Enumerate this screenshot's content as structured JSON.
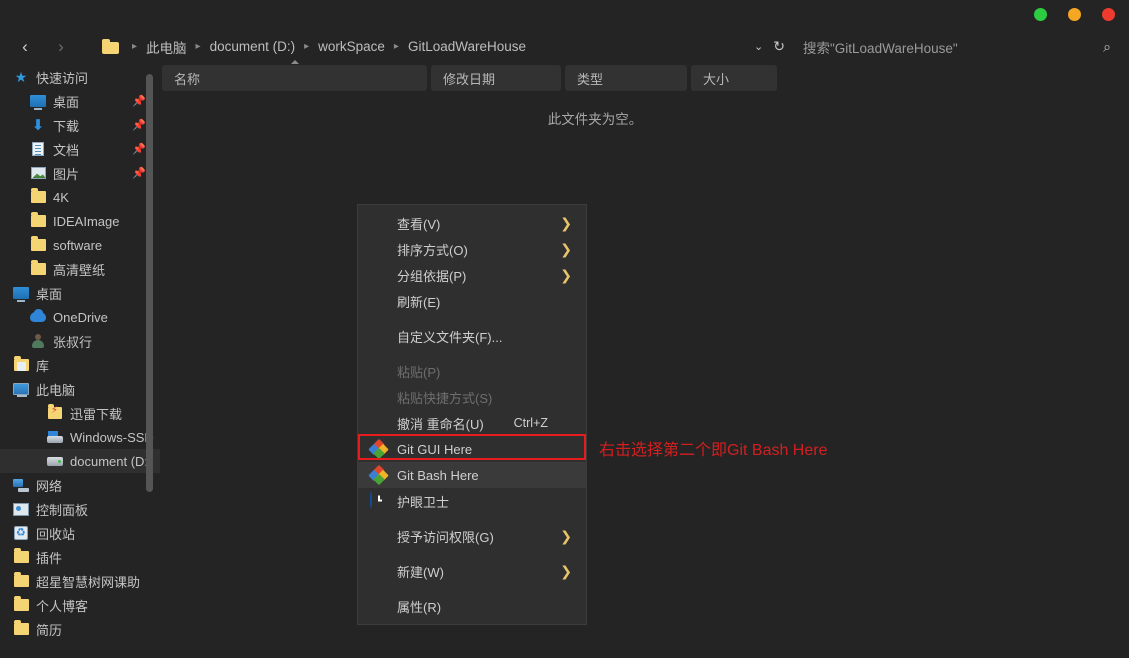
{
  "window": {
    "controls": [
      {
        "name": "minimize",
        "color": "#2ecc40"
      },
      {
        "name": "maximize",
        "color": "#f5a623"
      },
      {
        "name": "close",
        "color": "#ef3b2d"
      }
    ]
  },
  "addressbar": {
    "back_icon": "‹",
    "forward_icon": "›",
    "folder_icon": "folder-icon",
    "separator": "▸",
    "crumbs": [
      "此电脑",
      "document (D:)",
      "workSpace",
      "GitLoadWareHouse"
    ],
    "history_dropdown_icon": "⌄",
    "refresh_icon": "↻",
    "search_placeholder": "搜索\"GitLoadWareHouse\"",
    "search_icon": "⌕"
  },
  "sidebar": {
    "items": [
      {
        "label": "快速访问",
        "icon": "ic-star",
        "indent": 0,
        "pin": false,
        "selected": false
      },
      {
        "label": "桌面",
        "icon": "ic-monitor",
        "indent": 1,
        "pin": true,
        "selected": false
      },
      {
        "label": "下载",
        "icon": "ic-down",
        "indent": 1,
        "pin": true,
        "selected": false
      },
      {
        "label": "文档",
        "icon": "ic-doc",
        "indent": 1,
        "pin": true,
        "selected": false
      },
      {
        "label": "图片",
        "icon": "ic-pic",
        "indent": 1,
        "pin": true,
        "selected": false
      },
      {
        "label": "4K",
        "icon": "ic-folder",
        "indent": 1,
        "pin": false,
        "selected": false
      },
      {
        "label": "IDEAImage",
        "icon": "ic-folder",
        "indent": 1,
        "pin": false,
        "selected": false
      },
      {
        "label": "software",
        "icon": "ic-folder",
        "indent": 1,
        "pin": false,
        "selected": false
      },
      {
        "label": "高清壁纸",
        "icon": "ic-folder",
        "indent": 1,
        "pin": false,
        "selected": false
      },
      {
        "label": "桌面",
        "icon": "ic-monitor",
        "indent": 0,
        "pin": false,
        "selected": false
      },
      {
        "label": "OneDrive",
        "icon": "ic-cloud",
        "indent": 1,
        "pin": false,
        "selected": false
      },
      {
        "label": "张叔行",
        "icon": "ic-person",
        "indent": 1,
        "pin": false,
        "selected": false
      },
      {
        "label": "库",
        "icon": "ic-lib",
        "indent": 0,
        "pin": false,
        "selected": false
      },
      {
        "label": "此电脑",
        "icon": "ic-pc",
        "indent": 0,
        "pin": false,
        "selected": false
      },
      {
        "label": "迅雷下载",
        "icon": "ic-thunder",
        "indent": 2,
        "pin": false,
        "selected": false
      },
      {
        "label": "Windows-SSD",
        "icon": "ic-ssd",
        "indent": 2,
        "pin": false,
        "selected": false
      },
      {
        "label": "document (D:)",
        "icon": "ic-drive",
        "indent": 2,
        "pin": false,
        "selected": true
      },
      {
        "label": "网络",
        "icon": "ic-net",
        "indent": 0,
        "pin": false,
        "selected": false
      },
      {
        "label": "控制面板",
        "icon": "ic-panel",
        "indent": 0,
        "pin": false,
        "selected": false
      },
      {
        "label": "回收站",
        "icon": "ic-trash",
        "indent": 0,
        "pin": false,
        "selected": false
      },
      {
        "label": "插件",
        "icon": "ic-folder",
        "indent": 0,
        "pin": false,
        "selected": false
      },
      {
        "label": "超星智慧树网课助",
        "icon": "ic-folder",
        "indent": 0,
        "pin": false,
        "selected": false
      },
      {
        "label": "个人博客",
        "icon": "ic-folder",
        "indent": 0,
        "pin": false,
        "selected": false
      },
      {
        "label": "简历",
        "icon": "ic-folder",
        "indent": 0,
        "pin": false,
        "selected": false
      }
    ]
  },
  "filelist": {
    "columns": [
      {
        "label": "名称",
        "key": "name"
      },
      {
        "label": "修改日期",
        "key": "date"
      },
      {
        "label": "类型",
        "key": "type"
      },
      {
        "label": "大小",
        "key": "size"
      }
    ],
    "sorted_column": "名称",
    "empty_message": "此文件夹为空。",
    "rows": []
  },
  "context_menu": {
    "items": [
      {
        "label": "查看(V)",
        "icon": null,
        "submenu": true,
        "accel": "",
        "disabled": false,
        "highlighted": false,
        "sep_after": false
      },
      {
        "label": "排序方式(O)",
        "icon": null,
        "submenu": true,
        "accel": "",
        "disabled": false,
        "highlighted": false,
        "sep_after": false
      },
      {
        "label": "分组依据(P)",
        "icon": null,
        "submenu": true,
        "accel": "",
        "disabled": false,
        "highlighted": false,
        "sep_after": false
      },
      {
        "label": "刷新(E)",
        "icon": null,
        "submenu": false,
        "accel": "",
        "disabled": false,
        "highlighted": false,
        "sep_after": true
      },
      {
        "label": "自定义文件夹(F)...",
        "icon": null,
        "submenu": false,
        "accel": "",
        "disabled": false,
        "highlighted": false,
        "sep_after": true
      },
      {
        "label": "粘贴(P)",
        "icon": null,
        "submenu": false,
        "accel": "",
        "disabled": true,
        "highlighted": false,
        "sep_after": false
      },
      {
        "label": "粘贴快捷方式(S)",
        "icon": null,
        "submenu": false,
        "accel": "",
        "disabled": true,
        "highlighted": false,
        "sep_after": false
      },
      {
        "label": "撤消 重命名(U)",
        "icon": null,
        "submenu": false,
        "accel": "Ctrl+Z",
        "disabled": false,
        "highlighted": false,
        "sep_after": false
      },
      {
        "label": "Git GUI Here",
        "icon": "git-icon",
        "submenu": false,
        "accel": "",
        "disabled": false,
        "highlighted": false,
        "sep_after": false
      },
      {
        "label": "Git Bash Here",
        "icon": "git-icon",
        "submenu": false,
        "accel": "",
        "disabled": false,
        "highlighted": true,
        "sep_after": false
      },
      {
        "label": "护眼卫士",
        "icon": "clock-icon",
        "submenu": false,
        "accel": "",
        "disabled": false,
        "highlighted": false,
        "sep_after": true
      },
      {
        "label": "授予访问权限(G)",
        "icon": null,
        "submenu": true,
        "accel": "",
        "disabled": false,
        "highlighted": false,
        "sep_after": true
      },
      {
        "label": "新建(W)",
        "icon": null,
        "submenu": true,
        "accel": "",
        "disabled": false,
        "highlighted": false,
        "sep_after": true
      },
      {
        "label": "属性(R)",
        "icon": null,
        "submenu": false,
        "accel": "",
        "disabled": false,
        "highlighted": false,
        "sep_after": false
      }
    ],
    "submenu_arrow": "❯"
  },
  "annotation": {
    "text": "右击选择第二个即Git Bash Here",
    "color": "#d41f1f",
    "highlight_box_color": "#e81c1c"
  }
}
